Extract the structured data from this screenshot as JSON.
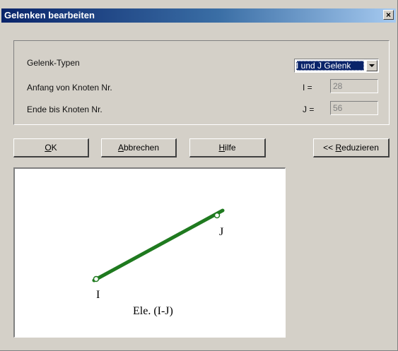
{
  "window": {
    "title": "Gelenken bearbeiten",
    "close_glyph": "×"
  },
  "form": {
    "gelenk_typen_label": "Gelenk-Typen",
    "gelenk_typen_value": "I und J Gelenk",
    "anfang_label": "Anfang von Knoten Nr.",
    "anfang_eq": "I =",
    "anfang_value": "28",
    "ende_label": "Ende bis Knoten Nr.",
    "ende_eq": "J =",
    "ende_value": "56"
  },
  "buttons": {
    "ok": {
      "mnemonic": "O",
      "rest": "K"
    },
    "abbrechen": {
      "mnemonic": "A",
      "rest": "bbrechen"
    },
    "hilfe": {
      "mnemonic": "H",
      "rest": "ilfe"
    },
    "reduzieren": {
      "prefix": "<< ",
      "mnemonic": "R",
      "rest": "eduzieren"
    }
  },
  "diagram": {
    "node_i_label": "I",
    "node_j_label": "J",
    "element_label": "Ele. (I-J)",
    "line_color": "#1f7a1f"
  }
}
